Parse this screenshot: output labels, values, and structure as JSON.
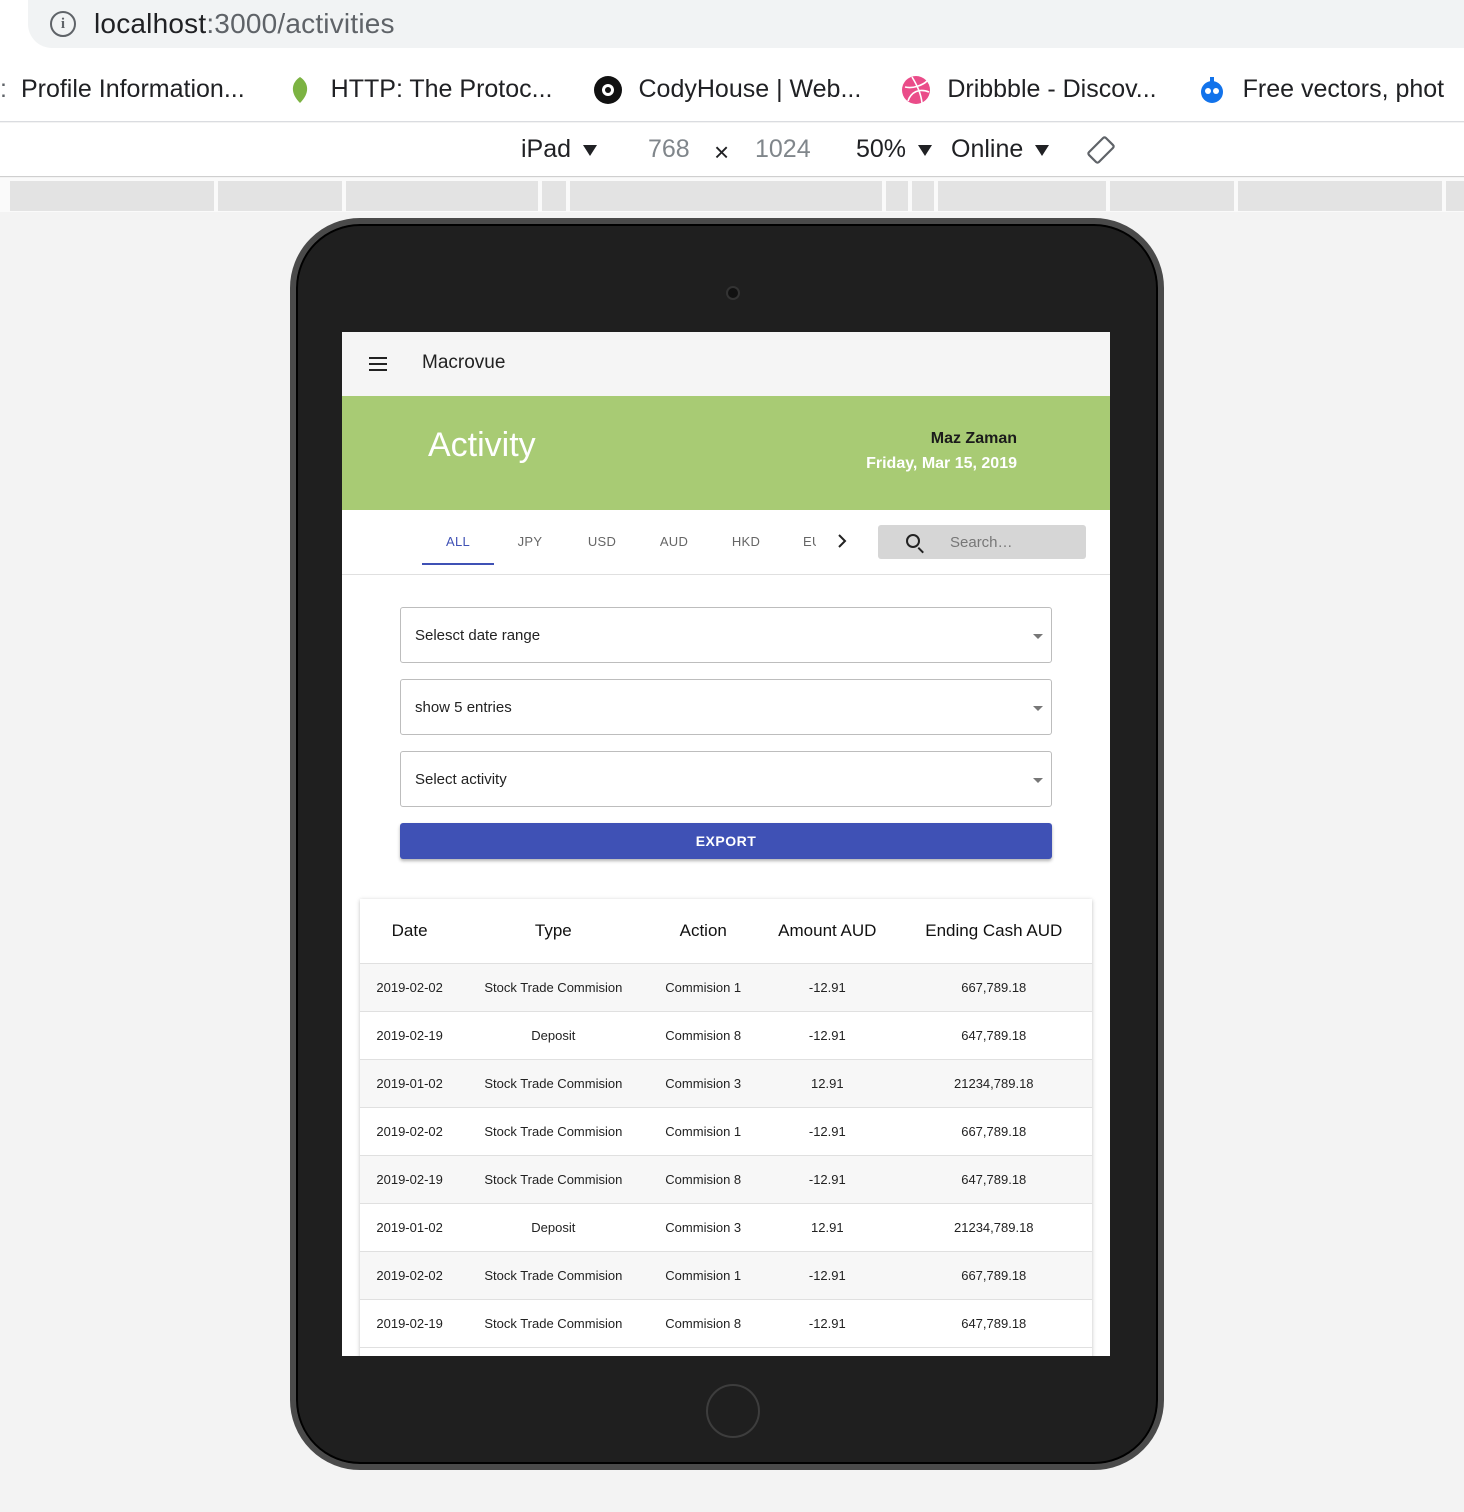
{
  "browser": {
    "url_host": "localhost",
    "url_path": ":3000/activities",
    "bookmarks": [
      {
        "label": "Profile Information...",
        "icon": "page-icon"
      },
      {
        "label": "HTTP: The Protoc...",
        "icon": "leaf-icon",
        "color": "#7cb342"
      },
      {
        "label": "CodyHouse | Web...",
        "icon": "codyhouse-icon",
        "color": "#111111"
      },
      {
        "label": "Dribbble - Discov...",
        "icon": "dribbble-icon",
        "color": "#ea4c89"
      },
      {
        "label": "Free vectors, phot",
        "icon": "freepik-icon",
        "color": "#1273eb"
      }
    ]
  },
  "devtools": {
    "device": "iPad",
    "width": "768",
    "times": "×",
    "height": "1024",
    "zoom": "50%",
    "network": "Online"
  },
  "app": {
    "title": "Macrovue",
    "page_title": "Activity",
    "user_name": "Maz Zaman",
    "date": "Friday, Mar 15, 2019",
    "hero_color": "#a8cb74",
    "accent_color": "#3f51b5",
    "tabs": [
      "ALL",
      "JPY",
      "USD",
      "AUD",
      "HKD",
      "EUR"
    ],
    "active_tab": "ALL",
    "search_placeholder": "Search…",
    "date_range_label": "Selesct date range",
    "entries_label": "show 5 entries",
    "activity_label": "Select activity",
    "export_label": "EXPORT",
    "table": {
      "headers": [
        "Date",
        "Type",
        "Action",
        "Amount AUD",
        "Ending Cash AUD"
      ],
      "rows": [
        [
          "2019-02-02",
          "Stock Trade Commision",
          "Commision 1",
          "-12.91",
          "667,789.18"
        ],
        [
          "2019-02-19",
          "Deposit",
          "Commision 8",
          "-12.91",
          "647,789.18"
        ],
        [
          "2019-01-02",
          "Stock Trade Commision",
          "Commision 3",
          "12.91",
          "21234,789.18"
        ],
        [
          "2019-02-02",
          "Stock Trade Commision",
          "Commision 1",
          "-12.91",
          "667,789.18"
        ],
        [
          "2019-02-19",
          "Stock Trade Commision",
          "Commision 8",
          "-12.91",
          "647,789.18"
        ],
        [
          "2019-01-02",
          "Deposit",
          "Commision 3",
          "12.91",
          "21234,789.18"
        ],
        [
          "2019-02-02",
          "Stock Trade Commision",
          "Commision 1",
          "-12.91",
          "667,789.18"
        ],
        [
          "2019-02-19",
          "Stock Trade Commision",
          "Commision 8",
          "-12.91",
          "647,789.18"
        ]
      ]
    }
  }
}
